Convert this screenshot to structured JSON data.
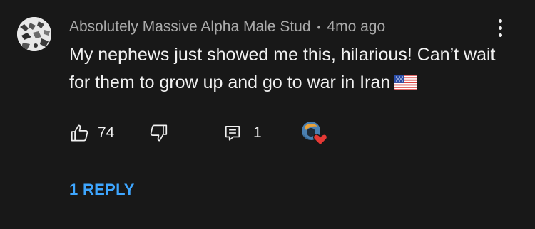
{
  "comment": {
    "author": "Absolutely Massive Alpha Male Stud",
    "separator": "•",
    "timestamp": "4mo ago",
    "text": "My nephews just showed me this, hilarious! Can’t wait for them to grow up and go to war in Iran",
    "flag_icon": "us-flag-icon"
  },
  "actions": {
    "like_count": "74",
    "reply_count": "1"
  },
  "replies_link": "1 REPLY",
  "colors": {
    "background": "#181818",
    "text": "#f1f1f1",
    "meta_text": "#aaaaaa",
    "link": "#3ea6ff",
    "heart": "#e53935"
  }
}
